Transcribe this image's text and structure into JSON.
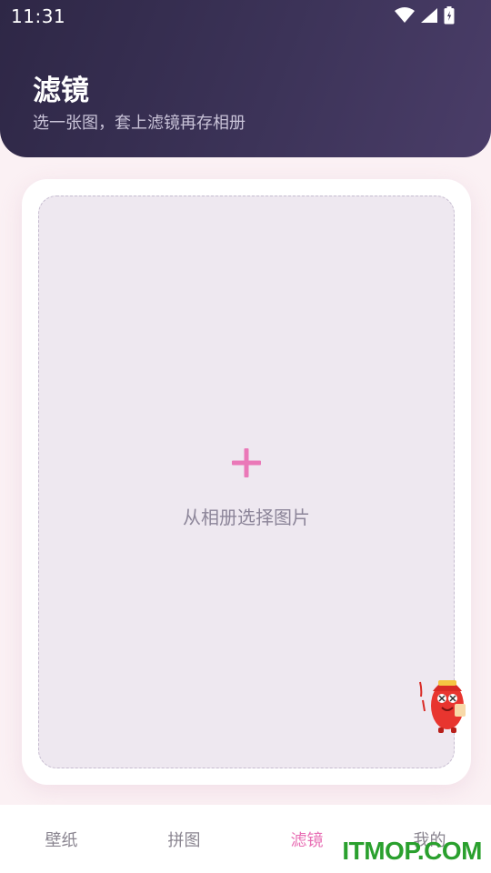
{
  "status_bar": {
    "time": "11:31"
  },
  "header": {
    "title": "滤镜",
    "subtitle": "选一张图，套上滤镜再存相册"
  },
  "upload": {
    "label": "从相册选择图片",
    "icon": "plus-icon"
  },
  "colors": {
    "accent": "#e86fb4",
    "header_dark": "#2e2746",
    "header_light": "#4a3d68",
    "page_bg": "#fbf1f4",
    "dropzone_bg": "#eee8f0"
  },
  "nav": {
    "items": [
      {
        "label": "壁纸",
        "active": false
      },
      {
        "label": "拼图",
        "active": false
      },
      {
        "label": "滤镜",
        "active": true
      },
      {
        "label": "我的",
        "active": false
      }
    ]
  },
  "watermark": "ITMOP.COM"
}
